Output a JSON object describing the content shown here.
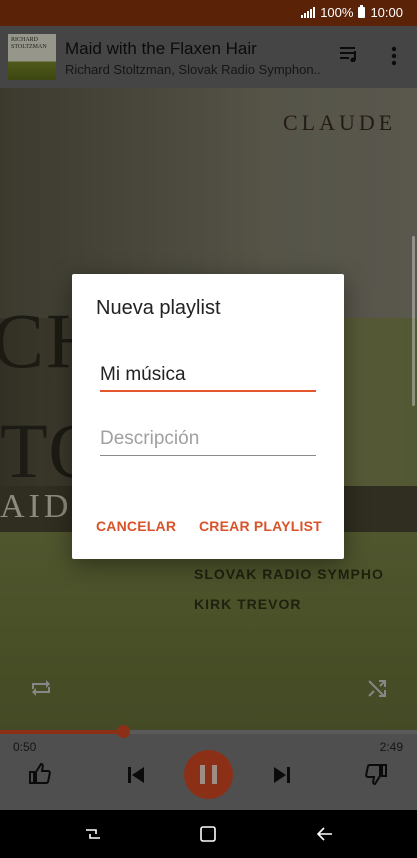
{
  "status_bar": {
    "battery": "100%",
    "time": "10:00"
  },
  "now_playing": {
    "title": "Maid with the Flaxen Hair",
    "artist": "Richard Stoltzman, Slovak Radio Symphon..",
    "thumb_text": "RICHARD STOLTZMAN"
  },
  "album_art": {
    "claude": "CLAUDE",
    "big_line1": "CH",
    "big_line2": "TO   M",
    "big_line3": "AID      KEN",
    "line_orchestra": "SLOVAK RADIO SYMPHO",
    "line_conductor": "KIRK TREVOR"
  },
  "player": {
    "time_current": "0:50",
    "time_total": "2:49",
    "progress_fraction": 0.296
  },
  "dialog": {
    "title": "Nueva playlist",
    "name_value": "Mi música",
    "description_placeholder": "Descripción",
    "cancel_label": "CANCELAR",
    "create_label": "CREAR PLAYLIST"
  },
  "colors": {
    "accent": "#d64a24",
    "status_bar": "#5a2307"
  }
}
